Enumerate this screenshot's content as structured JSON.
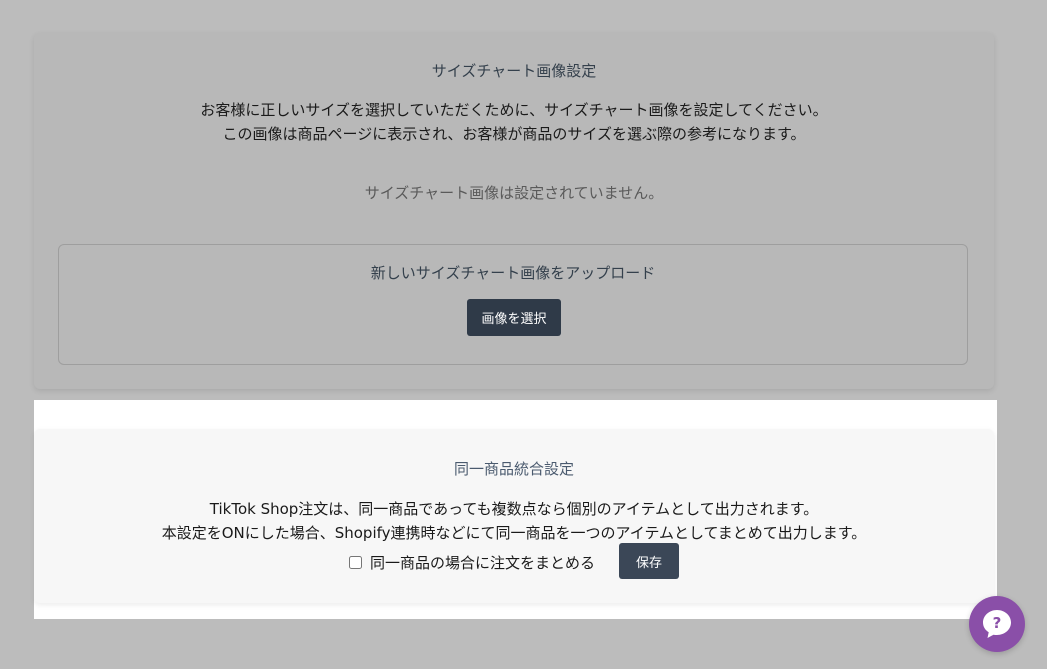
{
  "size_chart": {
    "title": "サイズチャート画像設定",
    "description_line1": "お客様に正しいサイズを選択していただくために、サイズチャート画像を設定してください。",
    "description_line2": "この画像は商品ページに表示され、お客様が商品のサイズを選ぶ際の参考になります。",
    "status": "サイズチャート画像は設定されていません。",
    "upload": {
      "title": "新しいサイズチャート画像をアップロード",
      "button_label": "画像を選択"
    }
  },
  "merge_settings": {
    "title": "同一商品統合設定",
    "description_line1": "TikTok Shop注文は、同一商品であっても複数点なら個別のアイテムとして出力されます。",
    "description_line2": "本設定をONにした場合、Shopify連携時などにて同一商品を一つのアイテムとしてまとめて出力します。",
    "checkbox_label": "同一商品の場合に注文をまとめる",
    "checkbox_checked": false,
    "save_label": "保存"
  },
  "help_widget": {
    "icon": "question-icon"
  },
  "colors": {
    "overlay": "#bcbcbc",
    "button": "#2f3a48",
    "help_widget": "#8a4fa8"
  }
}
